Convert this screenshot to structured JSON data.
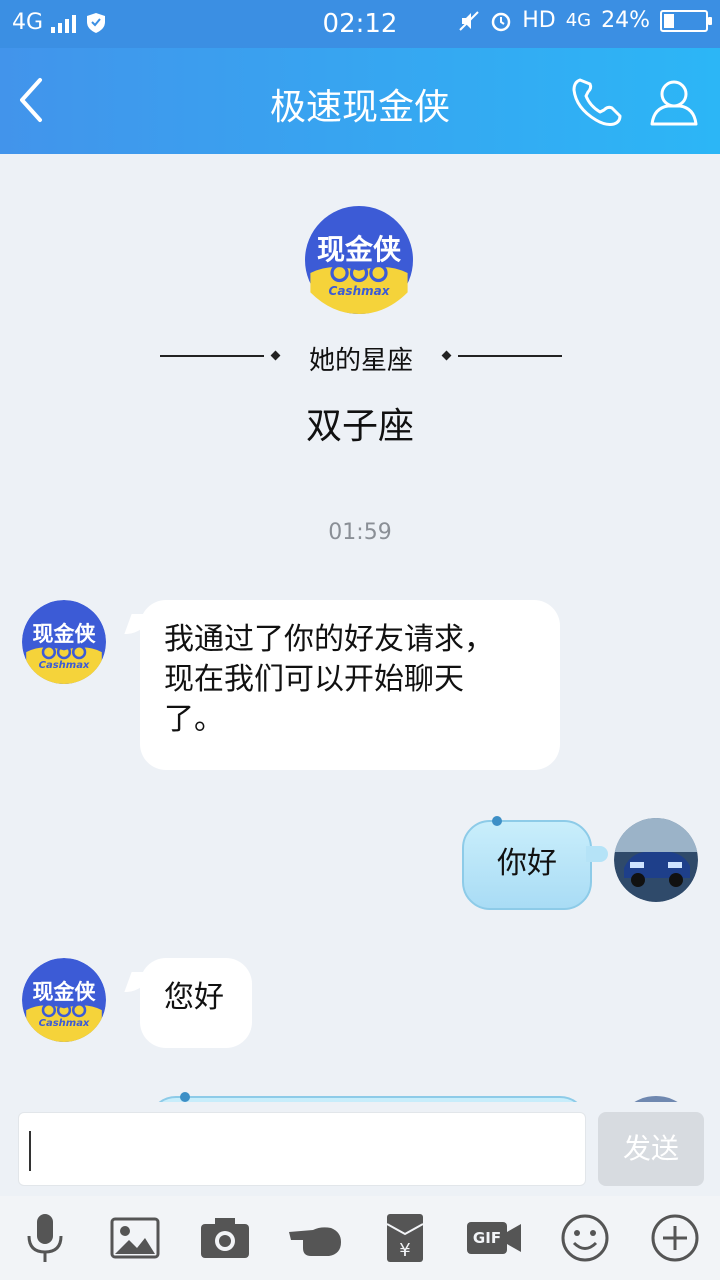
{
  "status_bar": {
    "network": "4G",
    "time": "02:12",
    "hd": "HD",
    "network_right": "4G",
    "battery_percent": "24%",
    "battery_level": 0.24
  },
  "header": {
    "title": "极速现金侠",
    "icons": [
      "back-icon",
      "phone-icon",
      "profile-icon"
    ]
  },
  "contact": {
    "logo_text": "现金侠",
    "logo_sub": "Cashmax",
    "sign_label": "她的星座",
    "sign_value": "双子座"
  },
  "chat": {
    "timestamp": "01:59",
    "messages": [
      {
        "from": "contact",
        "text": "我通过了你的好友请求，现在我们可以开始聊天了。",
        "lines": [
          "我通过了你的好友请求，",
          "现在我们可以开始聊天",
          "了。"
        ]
      },
      {
        "from": "me",
        "text": "你好"
      },
      {
        "from": "contact",
        "text": "您好"
      },
      {
        "from": "me",
        "text": ""
      }
    ]
  },
  "input": {
    "value": "",
    "send_label": "发送"
  },
  "toolbar": {
    "icons": [
      "microphone-icon",
      "image-icon",
      "camera-icon",
      "poke-icon",
      "red-packet-icon",
      "gif-icon",
      "emoji-icon",
      "plus-icon"
    ],
    "gif_label": "GIF"
  },
  "colors": {
    "header_start": "#4294eb",
    "header_end": "#2cb6f6",
    "logo_blue": "#3c5bd6",
    "logo_yellow": "#f5d33a"
  }
}
